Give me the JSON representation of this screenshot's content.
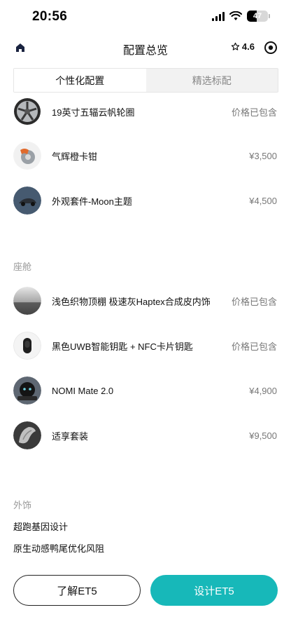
{
  "status_bar": {
    "time": "20:56",
    "battery": "47",
    "battery_level": 0.47
  },
  "nav": {
    "title": "配置总览",
    "rating": "4.6",
    "icons": [
      "home-icon",
      "star-icon",
      "target-icon"
    ]
  },
  "tabs": [
    {
      "label": "个性化配置",
      "active": true
    },
    {
      "label": "精选标配",
      "active": false
    }
  ],
  "exterior_items": [
    {
      "name": "19英寸五辐云帆轮圈",
      "price": "价格已包含",
      "thumb": "wheel"
    },
    {
      "name": "气辉橙卡钳",
      "price": "¥3,500",
      "thumb": "caliper"
    },
    {
      "name": "外观套件-Moon主题",
      "price": "¥4,500",
      "thumb": "moon-kit"
    }
  ],
  "cabin": {
    "title": "座舱",
    "items": [
      {
        "name": "浅色织物顶棚 极速灰Haptex合成皮内饰",
        "price": "价格已包含",
        "thumb": "interior"
      },
      {
        "name": "黑色UWB智能钥匙 + NFC卡片钥匙",
        "price": "价格已包含",
        "thumb": "key"
      },
      {
        "name": "NOMI Mate 2.0",
        "price": "¥4,900",
        "thumb": "nomi"
      },
      {
        "name": "适享套装",
        "price": "¥9,500",
        "thumb": "seat"
      }
    ]
  },
  "trim": {
    "title": "外饰",
    "lines": [
      "超跑基因设计",
      "原生动感鸭尾优化风阻"
    ]
  },
  "buttons": {
    "learn": "了解ET5",
    "design": "设计ET5"
  },
  "colors": {
    "accent": "#17b8b9",
    "text": "#111111",
    "muted": "#777777"
  }
}
